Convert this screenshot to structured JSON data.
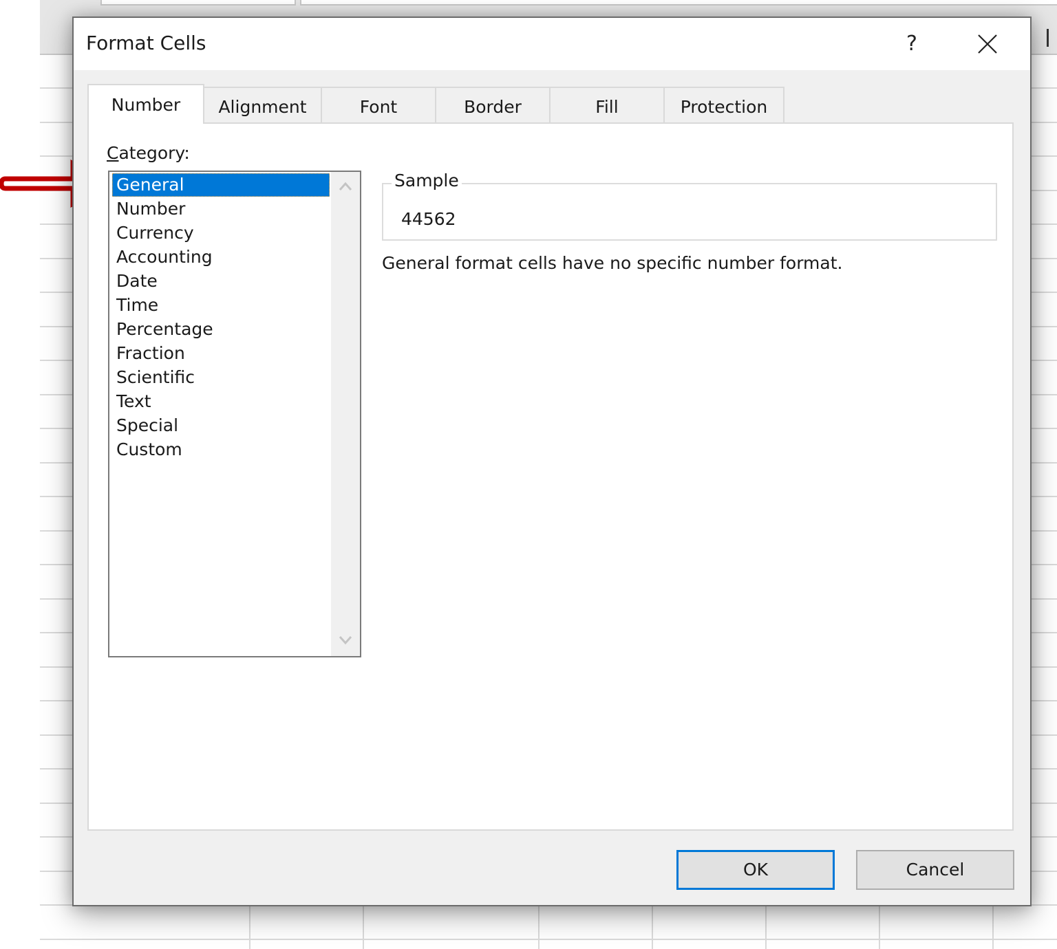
{
  "dialog": {
    "title": "Format Cells",
    "help_label": "?",
    "tabs": [
      {
        "label": "Number",
        "active": true
      },
      {
        "label": "Alignment",
        "active": false
      },
      {
        "label": "Font",
        "active": false
      },
      {
        "label": "Border",
        "active": false
      },
      {
        "label": "Fill",
        "active": false
      },
      {
        "label": "Protection",
        "active": false
      }
    ],
    "category": {
      "label_accesskey": "C",
      "label_rest": "ategory:",
      "items": [
        "General",
        "Number",
        "Currency",
        "Accounting",
        "Date",
        "Time",
        "Percentage",
        "Fraction",
        "Scientific",
        "Text",
        "Special",
        "Custom"
      ],
      "selected": "General"
    },
    "sample": {
      "legend": "Sample",
      "value": "44562"
    },
    "description": "General format cells have no specific number format.",
    "buttons": {
      "ok": "OK",
      "cancel": "Cancel"
    }
  },
  "colors": {
    "selection": "#0078d7",
    "annotation_arrow": "#c00000",
    "default_button_border": "#0078d7"
  },
  "annotation": {
    "icon": "arrow-right-icon",
    "points_to": "General"
  }
}
